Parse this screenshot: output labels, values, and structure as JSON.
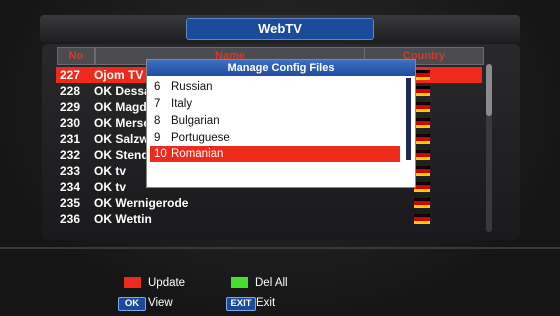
{
  "header": {
    "title": "WebTV"
  },
  "columns": {
    "no": "No",
    "name": "Name",
    "country": "Country"
  },
  "rows": [
    {
      "no": "227",
      "name": "Ojom TV",
      "selected": true
    },
    {
      "no": "228",
      "name": "OK Dessau"
    },
    {
      "no": "229",
      "name": "OK Magdeburg"
    },
    {
      "no": "230",
      "name": "OK Merseburg"
    },
    {
      "no": "231",
      "name": "OK Salzwedel"
    },
    {
      "no": "232",
      "name": "OK Stendal"
    },
    {
      "no": "233",
      "name": "OK tv"
    },
    {
      "no": "234",
      "name": "OK tv"
    },
    {
      "no": "235",
      "name": "OK Wernigerode"
    },
    {
      "no": "236",
      "name": "OK Wettin"
    }
  ],
  "flag_colors": [
    "#000000",
    "#dd0000",
    "#ffce00"
  ],
  "dialog": {
    "title": "Manage Config Files",
    "items": [
      {
        "num": "6",
        "label": "Russian"
      },
      {
        "num": "7",
        "label": "Italy"
      },
      {
        "num": "8",
        "label": "Bulgarian"
      },
      {
        "num": "9",
        "label": "Portuguese"
      },
      {
        "num": "10",
        "label": "Romanian",
        "selected": true
      }
    ]
  },
  "footer": {
    "update_label": "Update",
    "update_color": "#ee2a1d",
    "delall_label": "Del All",
    "delall_color": "#44e12a",
    "ok_key": "OK",
    "view_label": "View",
    "exit_key": "EXIT",
    "exit_label": "Exit"
  }
}
